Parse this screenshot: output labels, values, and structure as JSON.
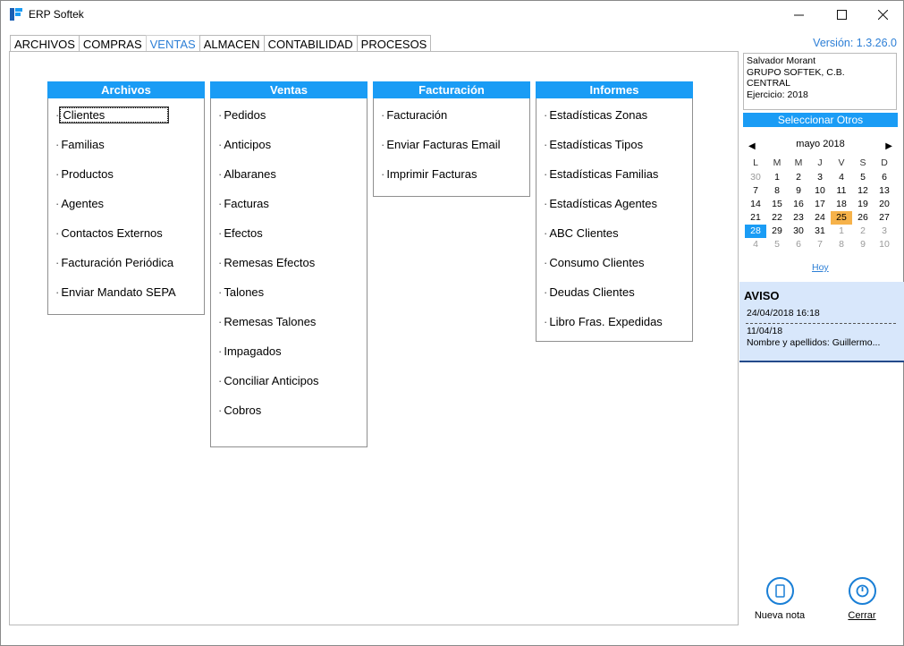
{
  "window": {
    "title": "ERP Softek",
    "version": "Versión: 1.3.26.0"
  },
  "menu": {
    "tabs": [
      {
        "label": "ARCHIVOS"
      },
      {
        "label": "COMPRAS"
      },
      {
        "label": "VENTAS",
        "active": true
      },
      {
        "label": "ALMACEN"
      },
      {
        "label": "CONTABILIDAD"
      },
      {
        "label": "PROCESOS"
      }
    ]
  },
  "panels": {
    "archivos": {
      "title": "Archivos",
      "items": [
        "Clientes",
        "Familias",
        "Productos",
        "Agentes",
        "Contactos Externos",
        "Facturación Periódica",
        "Enviar Mandato SEPA"
      ]
    },
    "ventas": {
      "title": "Ventas",
      "items": [
        "Pedidos",
        "Anticipos",
        "Albaranes",
        "Facturas",
        "Efectos",
        "Remesas Efectos",
        "Talones",
        "Remesas Talones",
        "Impagados",
        "Conciliar Anticipos",
        "Cobros"
      ]
    },
    "facturacion": {
      "title": "Facturación",
      "items": [
        "Facturación",
        "Enviar Facturas Email",
        "Imprimir Facturas"
      ]
    },
    "informes": {
      "title": "Informes",
      "items": [
        "Estadísticas Zonas",
        "Estadísticas Tipos",
        "Estadísticas Familias",
        "Estadísticas Agentes",
        "ABC Clientes",
        "Consumo Clientes",
        "Deudas Clientes",
        "Libro Fras. Expedidas"
      ]
    }
  },
  "item_bullet": "·",
  "sidebar": {
    "user": {
      "name": "Salvador Morant",
      "company": "GRUPO SOFTEK, C.B.",
      "branch": "CENTRAL",
      "ejercicio": "Ejercicio: 2018"
    },
    "select_others": "Seleccionar Otros",
    "calendar": {
      "month": "mayo 2018",
      "weekdays": [
        "L",
        "M",
        "M",
        "J",
        "V",
        "S",
        "D"
      ],
      "weeks": [
        [
          "30",
          "1",
          "2",
          "3",
          "4",
          "5",
          "6"
        ],
        [
          "7",
          "8",
          "9",
          "10",
          "11",
          "12",
          "13"
        ],
        [
          "14",
          "15",
          "16",
          "17",
          "18",
          "19",
          "20"
        ],
        [
          "21",
          "22",
          "23",
          "24",
          "25",
          "26",
          "27"
        ],
        [
          "28",
          "29",
          "30",
          "31",
          "1",
          "2",
          "3"
        ],
        [
          "4",
          "5",
          "6",
          "7",
          "8",
          "9",
          "10"
        ]
      ],
      "today": "25",
      "selected": "28",
      "today_link": "Hoy"
    },
    "aviso": {
      "title": "AVISO",
      "datetime": "24/04/2018 16:18",
      "line1": "11/04/18",
      "line2": "Nombre y apellidos: Guillermo..."
    },
    "actions": {
      "new_note": "Nueva nota",
      "close": "Cerrar"
    }
  },
  "colors": {
    "accent": "#1a9cf5",
    "link": "#2d7fd6",
    "today": "#f6b24a",
    "aviso_bg": "#d8e7fb"
  }
}
